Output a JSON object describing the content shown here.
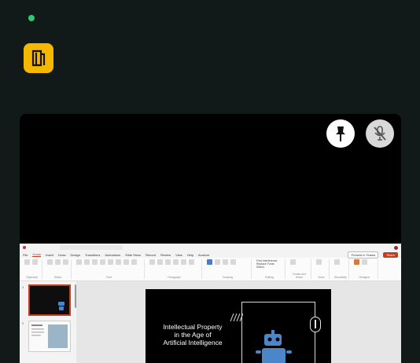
{
  "call": {
    "status_color": "#2ecc71",
    "leave_color": "#f5b800",
    "leave_icon": "door-exit-icon",
    "pin_icon": "pin-icon",
    "mic_icon": "mic-off-icon"
  },
  "app": {
    "menu": [
      "File",
      "Home",
      "Insert",
      "Draw",
      "Design",
      "Transitions",
      "Animations",
      "Slide Show",
      "Record",
      "Review",
      "View",
      "Help",
      "Acrobat"
    ],
    "active_menu": "Home",
    "present_label": "Present in Teams",
    "share_label": "Share",
    "ribbon_groups": [
      "Clipboard",
      "Slides",
      "Font",
      "Paragraph",
      "Drawing",
      "Editing",
      "Create and Share",
      "Voice",
      "Sensitivity",
      "Designer"
    ],
    "editing_items": [
      "Find Interference",
      "Replace Fonts",
      "Select"
    ],
    "shapes_label": "Shapes",
    "arrange_label": "Arrange",
    "dictate_label": "Dictate",
    "designer_label": "Designer",
    "new_slide_label": "New Slide"
  },
  "slides": {
    "numbers": [
      "1",
      "2"
    ],
    "current_title_lines": [
      "Intellectual Property",
      "in the Age of",
      "Artificial Intelligence"
    ]
  }
}
